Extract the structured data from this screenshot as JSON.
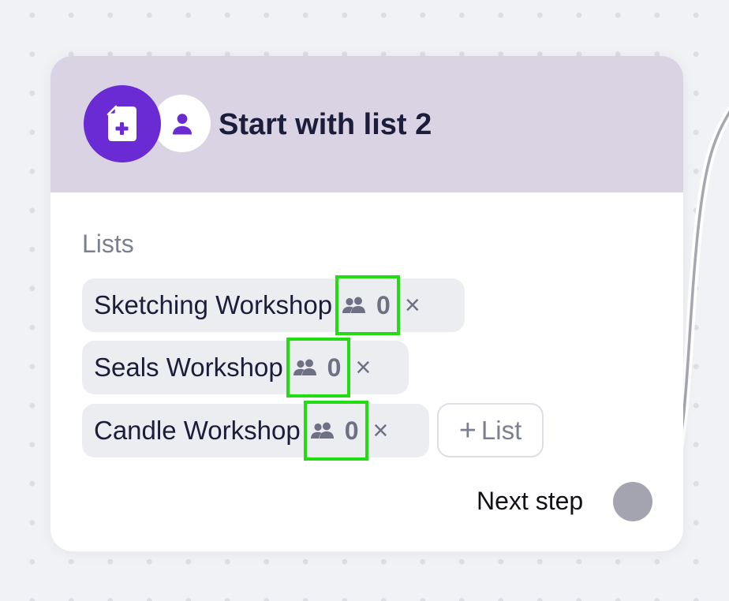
{
  "node": {
    "title": "Start with list 2",
    "icons": {
      "primary": "document-add-icon",
      "secondary": "user-icon",
      "primary_color": "#6b2bd4"
    },
    "lists_label": "Lists",
    "lists": [
      {
        "name": "Sketching Workshop",
        "count": "0",
        "count_icon": "people-icon",
        "remove_label": "×"
      },
      {
        "name": "Seals Workshop",
        "count": "0",
        "count_icon": "people-icon",
        "remove_label": "×"
      },
      {
        "name": "Candle Workshop",
        "count": "0",
        "count_icon": "people-icon",
        "remove_label": "×"
      }
    ],
    "add_list": {
      "plus": "+",
      "label": "List"
    },
    "next_step_label": "Next step"
  },
  "colors": {
    "header_bg": "#d9d3e3",
    "highlight": "#22dd11",
    "canvas_bg": "#f1f2f5"
  }
}
